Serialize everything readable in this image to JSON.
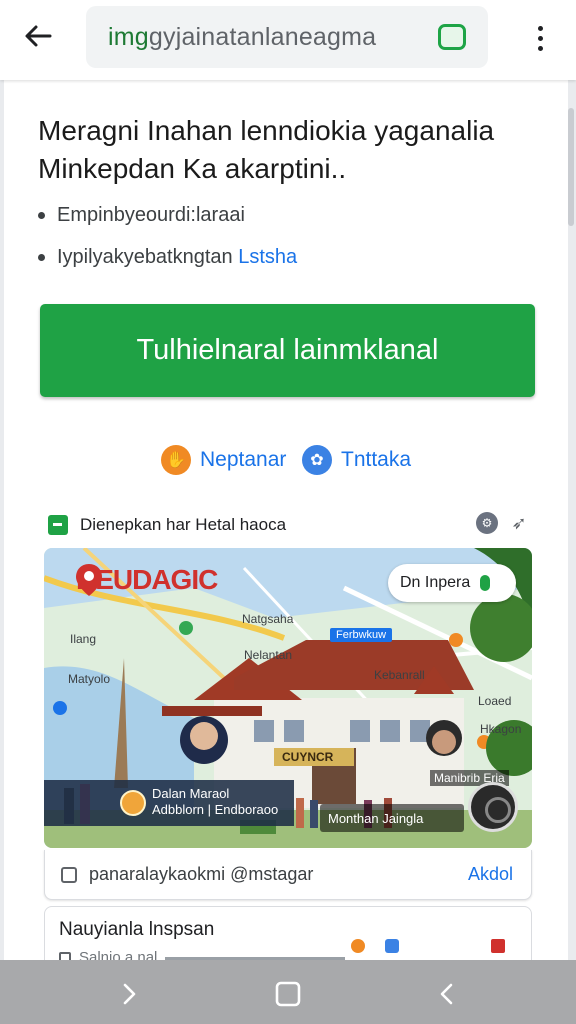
{
  "browser": {
    "url_green_part": "img",
    "url_rest": "gyjainatanlaneagma"
  },
  "article": {
    "headline": "Meragni Inahan lenndiokia yaganalia Minkepdan Ka akarptini..",
    "bullets": [
      {
        "text": "Empinbyeourdi:laraai",
        "link": ""
      },
      {
        "text": "Iypilyakyebatkngtan ",
        "link": "Lstsha"
      }
    ],
    "cta_label": "Tulhielnaral lainmklanal",
    "links": [
      {
        "label": "Neptanar",
        "icon": "orange-hand-icon"
      },
      {
        "label": "Tnttaka",
        "icon": "blue-chat-icon"
      }
    ],
    "source_label": "Dienepkan har Hetal haoca"
  },
  "image": {
    "map_title": "HEUDAGIC",
    "search_chip": "Dn Inpera",
    "map_labels": [
      "Ilang",
      "Matyolo",
      "Natgsaha",
      "Kebanrall",
      "Nelantan",
      "Loaed",
      "Hkagon"
    ],
    "map_tag": "Ferbwkuw",
    "banner_title": "Dalan Maraol",
    "banner_sub": "Adbblorn | Endboraoo",
    "building_sign": "CUYNCR",
    "right_banner": "Monthan Jaingla",
    "side_tag": "Manibrib Eria"
  },
  "caption_card": {
    "text": "panaralaykaokmi @mstagar",
    "action": "Akdol"
  },
  "next_card": {
    "title": "Nauyianla lnspsan",
    "sub": "Salnio a nal"
  },
  "colors": {
    "cta_green": "#1fa245",
    "link_blue": "#1a73e8",
    "map_title_red": "#d0312d"
  }
}
